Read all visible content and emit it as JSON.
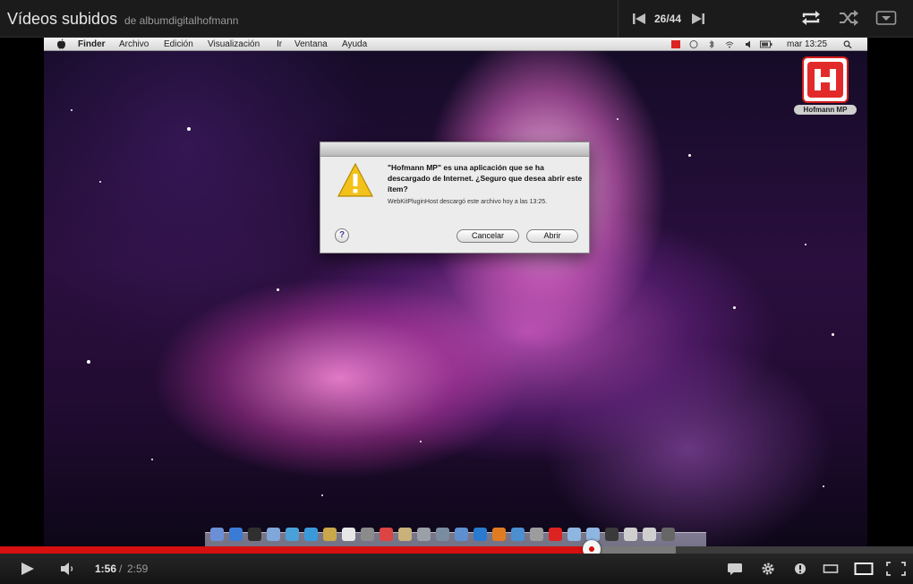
{
  "playlist": {
    "title": "Vídeos subidos",
    "owner": "de albumdigitalhofmann",
    "position": "26/44"
  },
  "video_frame": {
    "menubar": {
      "items": [
        "Finder",
        "Archivo",
        "Edición",
        "Visualización",
        "Ir",
        "Ventana",
        "Ayuda"
      ],
      "clock": "mar 13:25"
    },
    "desktop_icon": {
      "label": "Hofmann MP"
    },
    "dialog": {
      "message": "\"Hofmann MP\" es una aplicación que se ha descargado de Internet. ¿Seguro que desea abrir este ítem?",
      "detail": "WebKitPluginHost descargó este archivo hoy a las 13:25.",
      "cancel_label": "Cancelar",
      "open_label": "Abrir"
    }
  },
  "player": {
    "current_time": "1:56",
    "separator": "/",
    "duration": "2:59",
    "progress_fraction": 0.648,
    "buffered_fraction": 0.74
  },
  "colors": {
    "accent_red": "#d60f0f",
    "bar_bg": "#1b1b1b"
  },
  "icons": [
    "previous-icon",
    "next-icon",
    "loop-icon",
    "shuffle-icon",
    "playlist-toggle-icon",
    "play-icon",
    "volume-icon",
    "captions-icon",
    "settings-icon",
    "annotations-icon",
    "small-player-icon",
    "large-player-icon",
    "fullscreen-icon"
  ]
}
